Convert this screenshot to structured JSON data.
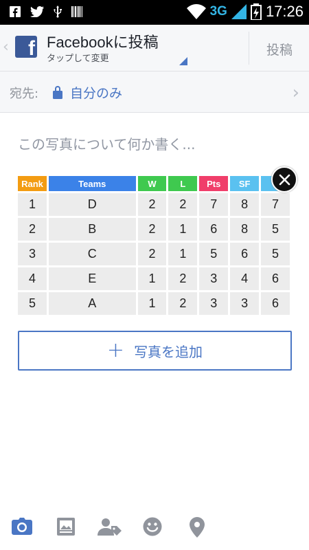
{
  "status_bar": {
    "network": "3G",
    "time": "17:26"
  },
  "header": {
    "title": "Facebookに投稿",
    "subtitle": "タップして変更",
    "post_label": "投稿"
  },
  "audience": {
    "label": "宛先:",
    "value": "自分のみ"
  },
  "composer": {
    "placeholder": "この写真について何か書く..."
  },
  "photo_table": {
    "headers": [
      "Rank",
      "Teams",
      "W",
      "L",
      "Pts",
      "SF",
      ""
    ],
    "rows": [
      [
        "1",
        "D",
        "2",
        "2",
        "7",
        "8",
        "7"
      ],
      [
        "2",
        "B",
        "2",
        "1",
        "6",
        "8",
        "5"
      ],
      [
        "3",
        "C",
        "2",
        "1",
        "5",
        "6",
        "5"
      ],
      [
        "4",
        "E",
        "1",
        "2",
        "3",
        "4",
        "6"
      ],
      [
        "5",
        "A",
        "1",
        "2",
        "3",
        "3",
        "6"
      ]
    ]
  },
  "add_photo": {
    "plus": "+",
    "label": "写真を追加"
  },
  "toolbar": {
    "icons": [
      "camera-icon",
      "photo-album-icon",
      "tag-people-icon",
      "emoji-icon",
      "location-icon"
    ]
  },
  "colors": {
    "accent": "#4a76c4",
    "facebook": "#3b5998"
  }
}
